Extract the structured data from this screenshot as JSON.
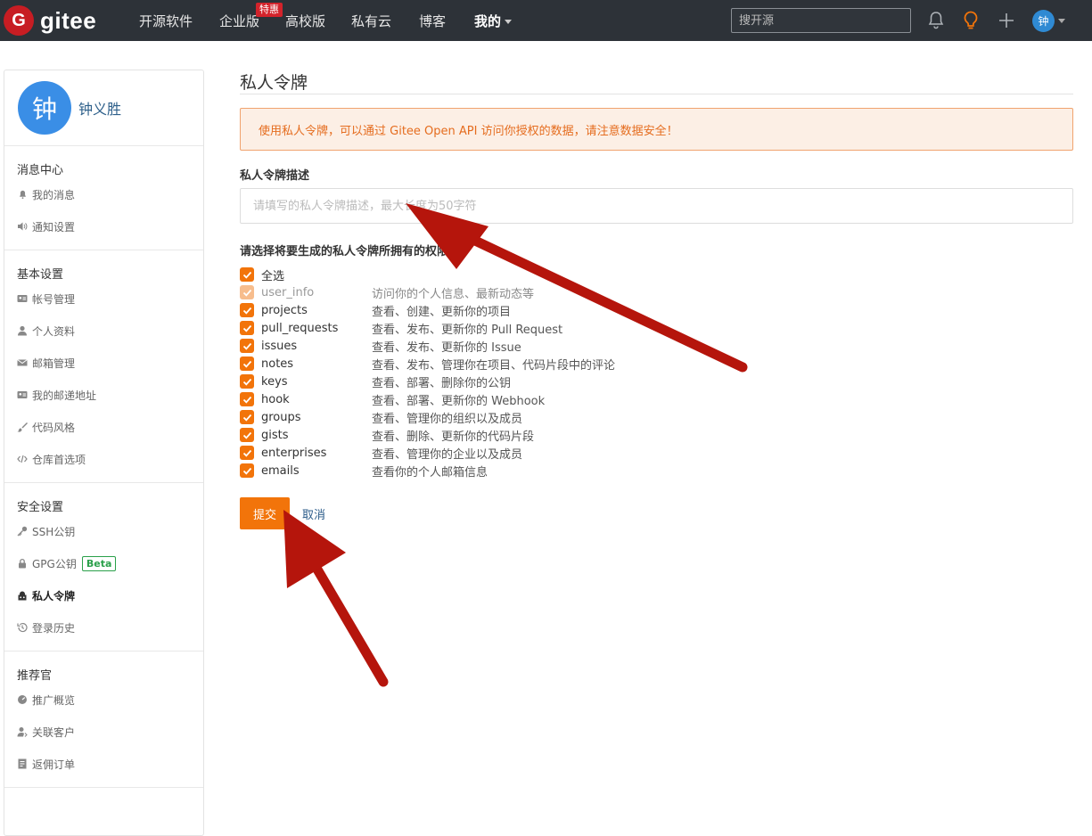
{
  "topbar": {
    "logo_glyph": "G",
    "logo_text": "gitee",
    "nav": [
      {
        "label": "开源软件"
      },
      {
        "label": "企业版"
      },
      {
        "label": "高校版"
      },
      {
        "label": "私有云"
      },
      {
        "label": "博客"
      },
      {
        "label": "我的"
      }
    ],
    "special_badge": "特惠",
    "search_placeholder": "搜开源",
    "icons": [
      "bell-icon",
      "lightbulb-icon",
      "plus-icon"
    ],
    "avatar_text": "钟",
    "brand_color": "#c71d23",
    "accent_color": "#f2740a"
  },
  "sidebar": {
    "avatar_text": "钟",
    "user_name": "钟义胜",
    "sections": [
      {
        "title": "消息中心",
        "items": [
          {
            "label": "我的消息",
            "icon": "bell-icon"
          },
          {
            "label": "通知设置",
            "icon": "speaker-icon"
          }
        ]
      },
      {
        "title": "基本设置",
        "items": [
          {
            "label": "帐号管理",
            "icon": "id-card-icon"
          },
          {
            "label": "个人资料",
            "icon": "user-icon"
          },
          {
            "label": "邮箱管理",
            "icon": "envelope-icon"
          },
          {
            "label": "我的邮递地址",
            "icon": "address-card-icon"
          },
          {
            "label": "代码风格",
            "icon": "brush-icon"
          },
          {
            "label": "仓库首选项",
            "icon": "code-icon"
          }
        ]
      },
      {
        "title": "安全设置",
        "items": [
          {
            "label": "SSH公钥",
            "icon": "key-icon"
          },
          {
            "label": "GPG公钥",
            "icon": "lock-icon",
            "badge": "Beta"
          },
          {
            "label": "私人令牌",
            "icon": "token-icon",
            "active": true
          },
          {
            "label": "登录历史",
            "icon": "history-icon"
          }
        ]
      },
      {
        "title": "推荐官",
        "items": [
          {
            "label": "推广概览",
            "icon": "dashboard-icon"
          },
          {
            "label": "关联客户",
            "icon": "user-link-icon"
          },
          {
            "label": "返佣订单",
            "icon": "order-icon"
          }
        ]
      }
    ]
  },
  "main": {
    "title": "私人令牌",
    "notice": "使用私人令牌，可以通过 Gitee Open API 访问你授权的数据，请注意数据安全！",
    "desc_label": "私人令牌描述",
    "desc_placeholder": "请填写的私人令牌描述，最大长度为50字符",
    "perm_label": "请选择将要生成的私人令牌所拥有的权限",
    "select_all": "全选",
    "permissions": [
      {
        "name": "user_info",
        "desc": "访问你的个人信息、最新动态等",
        "checked": true,
        "disabled": true
      },
      {
        "name": "projects",
        "desc": "查看、创建、更新你的项目",
        "checked": true
      },
      {
        "name": "pull_requests",
        "desc": "查看、发布、更新你的 Pull Request",
        "checked": true
      },
      {
        "name": "issues",
        "desc": "查看、发布、更新你的 Issue",
        "checked": true
      },
      {
        "name": "notes",
        "desc": "查看、发布、管理你在项目、代码片段中的评论",
        "checked": true
      },
      {
        "name": "keys",
        "desc": "查看、部署、删除你的公钥",
        "checked": true
      },
      {
        "name": "hook",
        "desc": "查看、部署、更新你的 Webhook",
        "checked": true
      },
      {
        "name": "groups",
        "desc": "查看、管理你的组织以及成员",
        "checked": true
      },
      {
        "name": "gists",
        "desc": "查看、删除、更新你的代码片段",
        "checked": true
      },
      {
        "name": "enterprises",
        "desc": "查看、管理你的企业以及成员",
        "checked": true
      },
      {
        "name": "emails",
        "desc": "查看你的个人邮箱信息",
        "checked": true
      }
    ],
    "submit_label": "提交",
    "cancel_label": "取消"
  },
  "annotation_color": "#b5150c"
}
